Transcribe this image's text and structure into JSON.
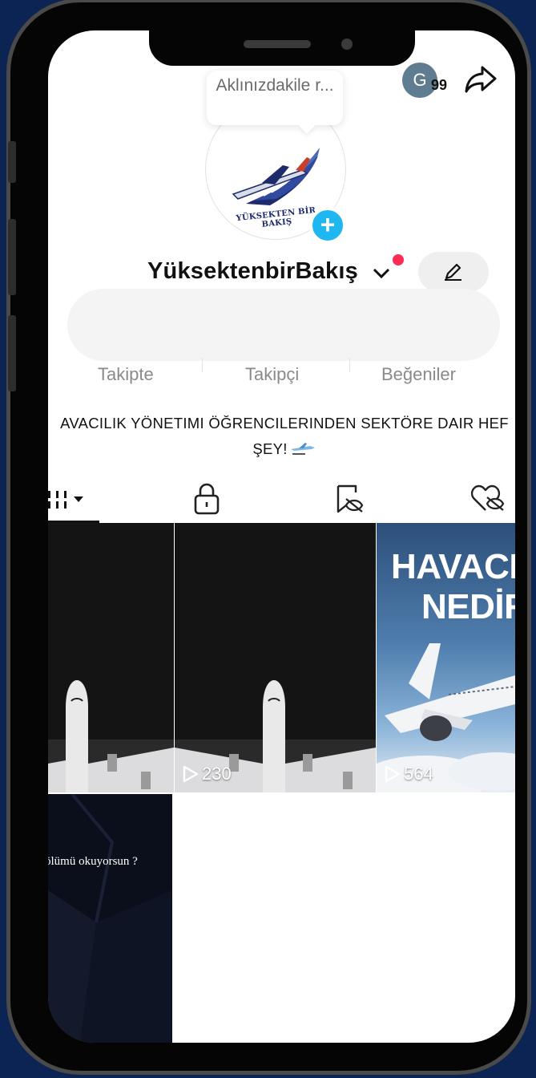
{
  "profile": {
    "note_bubble": "Aklınızdakile r...",
    "avatar_logo_text": "YÜKSEKTEN BİR BAKIŞ",
    "story_initial": "G",
    "story_count": "99",
    "username": "YüksektenbirBakış"
  },
  "stats": {
    "following_label": "Takipte",
    "followers_label": "Takipçi",
    "likes_label": "Beğeniler"
  },
  "bio": {
    "line1": "AVACILIK YÖNETIMI ÖĞRENCILERINDEN SEKTÖRE DAIR HEF",
    "line2": "ŞEY!"
  },
  "tabs": [
    {
      "name": "videos",
      "icon": "grid-icon"
    },
    {
      "name": "private",
      "icon": "lock-icon"
    },
    {
      "name": "hidden",
      "icon": "eye-off-icon"
    },
    {
      "name": "liked",
      "icon": "heart-off-icon"
    }
  ],
  "videos": [
    {
      "type": "plane-dark",
      "views": ""
    },
    {
      "type": "plane-dark",
      "views": "230"
    },
    {
      "type": "plane-sky",
      "title_line1": "HAVACI",
      "title_line2": "NEDİR",
      "views": "564"
    },
    {
      "type": "dark-text",
      "caption": "ölümü okuyorsun ?"
    }
  ],
  "colors": {
    "background": "#0c2454",
    "accent_plus": "#20b7f0",
    "notification_dot": "#fe2c55"
  }
}
